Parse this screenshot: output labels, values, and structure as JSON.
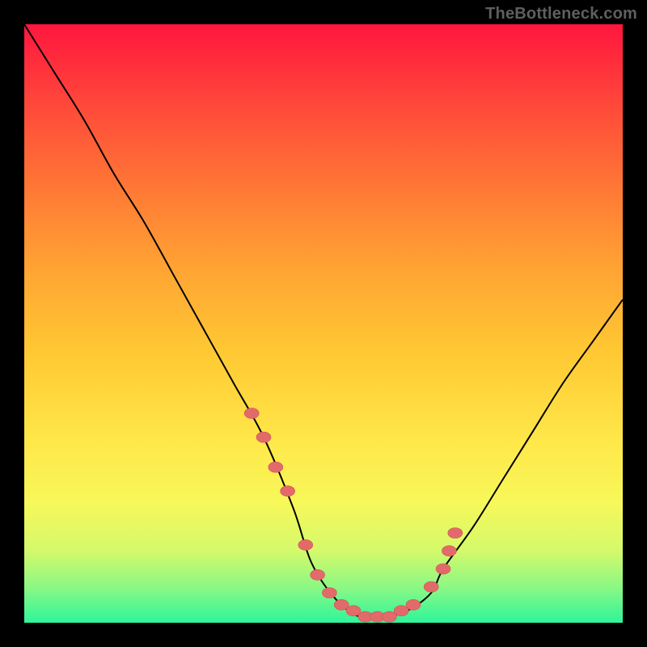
{
  "watermark": "TheBottleneck.com",
  "chart_data": {
    "type": "line",
    "title": "",
    "xlabel": "",
    "ylabel": "",
    "xlim": [
      0,
      100
    ],
    "ylim": [
      0,
      100
    ],
    "series": [
      {
        "name": "bottleneck-curve",
        "x": [
          0,
          5,
          10,
          15,
          20,
          25,
          30,
          35,
          40,
          45,
          48,
          52,
          56,
          60,
          64,
          68,
          70,
          75,
          80,
          85,
          90,
          95,
          100
        ],
        "y": [
          100,
          92,
          84,
          75,
          67,
          58,
          49,
          40,
          31,
          19,
          10,
          4,
          1,
          1,
          2,
          5,
          9,
          16,
          24,
          32,
          40,
          47,
          54
        ]
      }
    ],
    "highlight_points": {
      "name": "sample-dots",
      "x": [
        38,
        40,
        42,
        44,
        47,
        49,
        51,
        53,
        55,
        57,
        59,
        61,
        63,
        65,
        68,
        70,
        71,
        72
      ],
      "y": [
        35,
        31,
        26,
        22,
        13,
        8,
        5,
        3,
        2,
        1,
        1,
        1,
        2,
        3,
        6,
        9,
        12,
        15
      ]
    },
    "gradient_stops": [
      {
        "pos": 0,
        "color": "#ff163e"
      },
      {
        "pos": 14,
        "color": "#ff4a3a"
      },
      {
        "pos": 28,
        "color": "#ff7a35"
      },
      {
        "pos": 40,
        "color": "#ffa133"
      },
      {
        "pos": 55,
        "color": "#ffc933"
      },
      {
        "pos": 70,
        "color": "#ffe84a"
      },
      {
        "pos": 80,
        "color": "#f7f85a"
      },
      {
        "pos": 88,
        "color": "#d4f96b"
      },
      {
        "pos": 94,
        "color": "#8cf884"
      },
      {
        "pos": 100,
        "color": "#2ef59a"
      }
    ]
  }
}
